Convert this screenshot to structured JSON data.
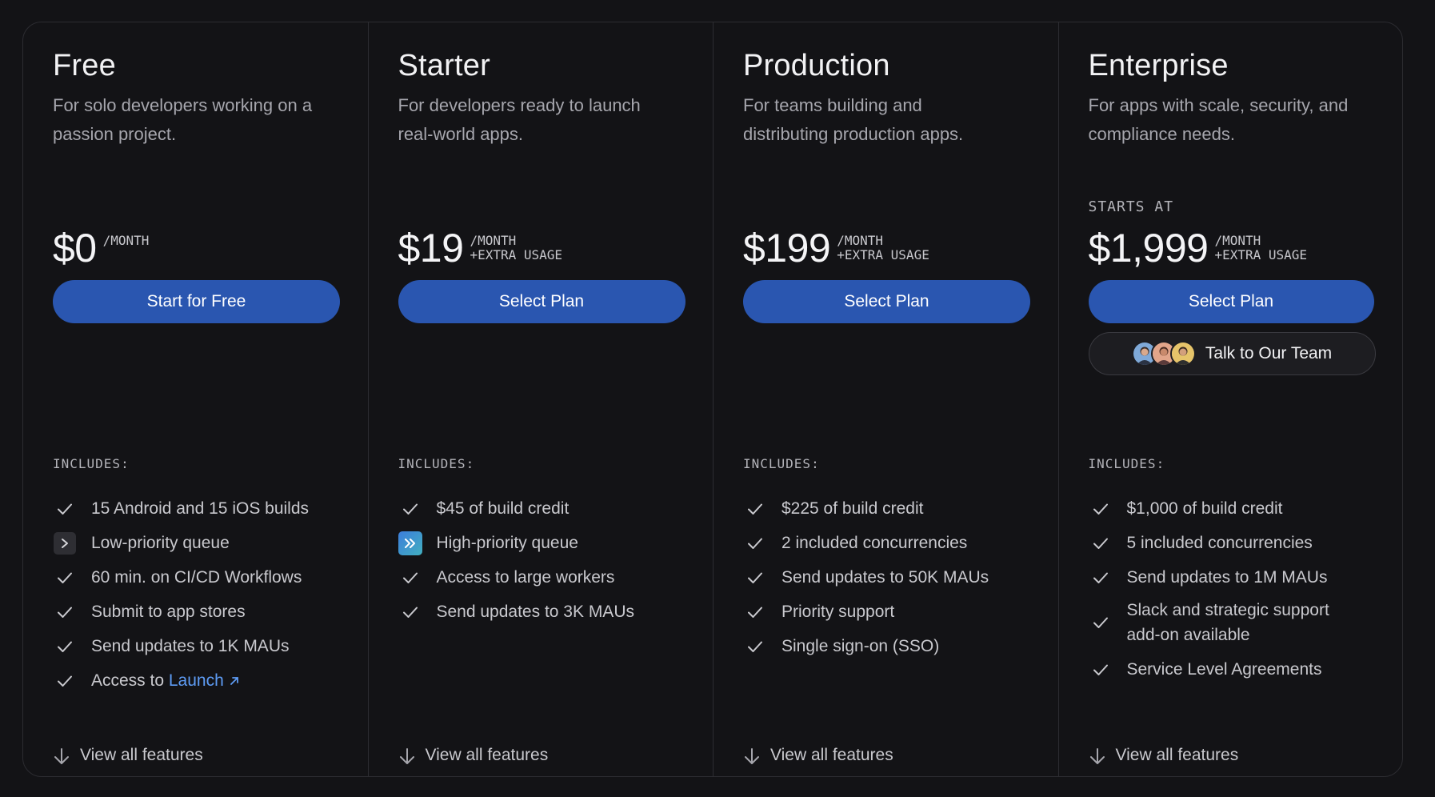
{
  "plans": [
    {
      "name": "Free",
      "description": "For solo developers working on a passion project.",
      "price": "$0",
      "price_meta": "/MONTH",
      "cta": "Start for Free",
      "includes_label": "INCLUDES:",
      "features": [
        {
          "icon": "check-icon",
          "text": "15 Android and 15 iOS builds"
        },
        {
          "icon": "chevron-right-icon",
          "text": "Low-priority queue"
        },
        {
          "icon": "check-icon",
          "text": "60 min. on CI/CD Workflows"
        },
        {
          "icon": "check-icon",
          "text": "Submit to app stores"
        },
        {
          "icon": "check-icon",
          "text": "Send updates to 1K MAUs"
        },
        {
          "icon": "check-icon",
          "text": "Access to ",
          "link": "Launch"
        }
      ],
      "view_all": "View all features"
    },
    {
      "name": "Starter",
      "description": "For developers ready to launch real-world apps.",
      "price": "$19",
      "price_meta": "/MONTH\n+EXTRA USAGE",
      "cta": "Select Plan",
      "includes_label": "INCLUDES:",
      "features": [
        {
          "icon": "check-icon",
          "text": "$45 of build credit"
        },
        {
          "icon": "double-chevron-right-icon",
          "text": "High-priority queue"
        },
        {
          "icon": "check-icon",
          "text": "Access to large workers"
        },
        {
          "icon": "check-icon",
          "text": "Send updates to 3K MAUs"
        }
      ],
      "view_all": "View all features"
    },
    {
      "name": "Production",
      "description": "For teams building and distributing production apps.",
      "price": "$199",
      "price_meta": "/MONTH\n+EXTRA USAGE",
      "cta": "Select Plan",
      "includes_label": "INCLUDES:",
      "features": [
        {
          "icon": "check-icon",
          "text": "$225 of build credit"
        },
        {
          "icon": "check-icon",
          "text": "2 included concurrencies"
        },
        {
          "icon": "check-icon",
          "text": "Send updates to 50K MAUs"
        },
        {
          "icon": "check-icon",
          "text": "Priority support"
        },
        {
          "icon": "check-icon",
          "text": "Single sign-on (SSO)"
        }
      ],
      "view_all": "View all features"
    },
    {
      "name": "Enterprise",
      "description": "For apps with scale, security, and compliance needs.",
      "starts_at": "STARTS AT",
      "price": "$1,999",
      "price_meta": "/MONTH\n+EXTRA USAGE",
      "cta": "Select Plan",
      "secondary_cta": "Talk to Our Team",
      "includes_label": "INCLUDES:",
      "features": [
        {
          "icon": "check-icon",
          "text": "$1,000 of build credit"
        },
        {
          "icon": "check-icon",
          "text": "5 included concurrencies"
        },
        {
          "icon": "check-icon",
          "text": "Send updates to 1M MAUs"
        },
        {
          "icon": "check-icon",
          "text": "Slack and strategic support add-on available"
        },
        {
          "icon": "check-icon",
          "text": "Service Level Agreements"
        }
      ],
      "view_all": "View all features"
    }
  ],
  "colors": {
    "background": "#131316",
    "primary_button": "#2a56b0",
    "link": "#5e9cf5"
  }
}
